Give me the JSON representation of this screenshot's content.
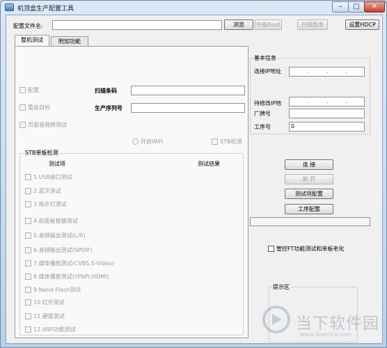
{
  "window": {
    "title": "机顶盒生产配置工具",
    "min_glyph": "–",
    "max_glyph": "□",
    "close_glyph": "✕"
  },
  "top_bar": {
    "config_label": "配置文件名:",
    "config_value": "",
    "browse": "浏览",
    "upgrade_boot": "升级Boot",
    "upgrade_version": "升级版本",
    "set_hdcp": "设置HDCP"
  },
  "tabs": [
    "整机测试",
    "附加功能"
  ],
  "whole_test": {
    "checks": [
      "配置",
      "重启自检",
      "页面音视频测试"
    ],
    "scan_code_label": "扫描条码",
    "scan_code_value": "",
    "serial_label": "生产序列号",
    "serial_value": "",
    "wifi_radio": "开启WiFi",
    "stb_check": "STB检测"
  },
  "stb_board": {
    "title": "STB单板检测",
    "col_item": "测试项",
    "col_result": "测试结果",
    "items": [
      "1.USB接口测试",
      "2.蓝牙测试",
      "3.指示灯测试",
      "4.前面板按键测试",
      "5.音频输出测试(L/R)",
      "6.音频输出测试(SPDIF)",
      "7.媒体播放测试(CVBS,S-Video)",
      "8.媒体播放测试(YPbPr,HDMI)",
      "9.Nand Flash测试",
      "10.红外测试",
      "11.硬盘测试",
      "12.WiFi功能测试"
    ]
  },
  "basic_info": {
    "title": "基本信息",
    "connect_ip_label": "连接IP地址",
    "modify_ip_label": "待修改IP地",
    "factory_label": "厂牌号",
    "factory_value": "",
    "station_label": "工序号",
    "station_value": "0",
    "ip_dots": ".",
    "connect": "连 接",
    "disconnect": "断 开",
    "test_item_config": "测试项配置",
    "station_config": "工序配置",
    "aging_check": "管控FT功能测试和单板老化",
    "tip_title": "提示区"
  },
  "watermark": {
    "text": "当下软件园",
    "sub": "www.downxia.com"
  }
}
